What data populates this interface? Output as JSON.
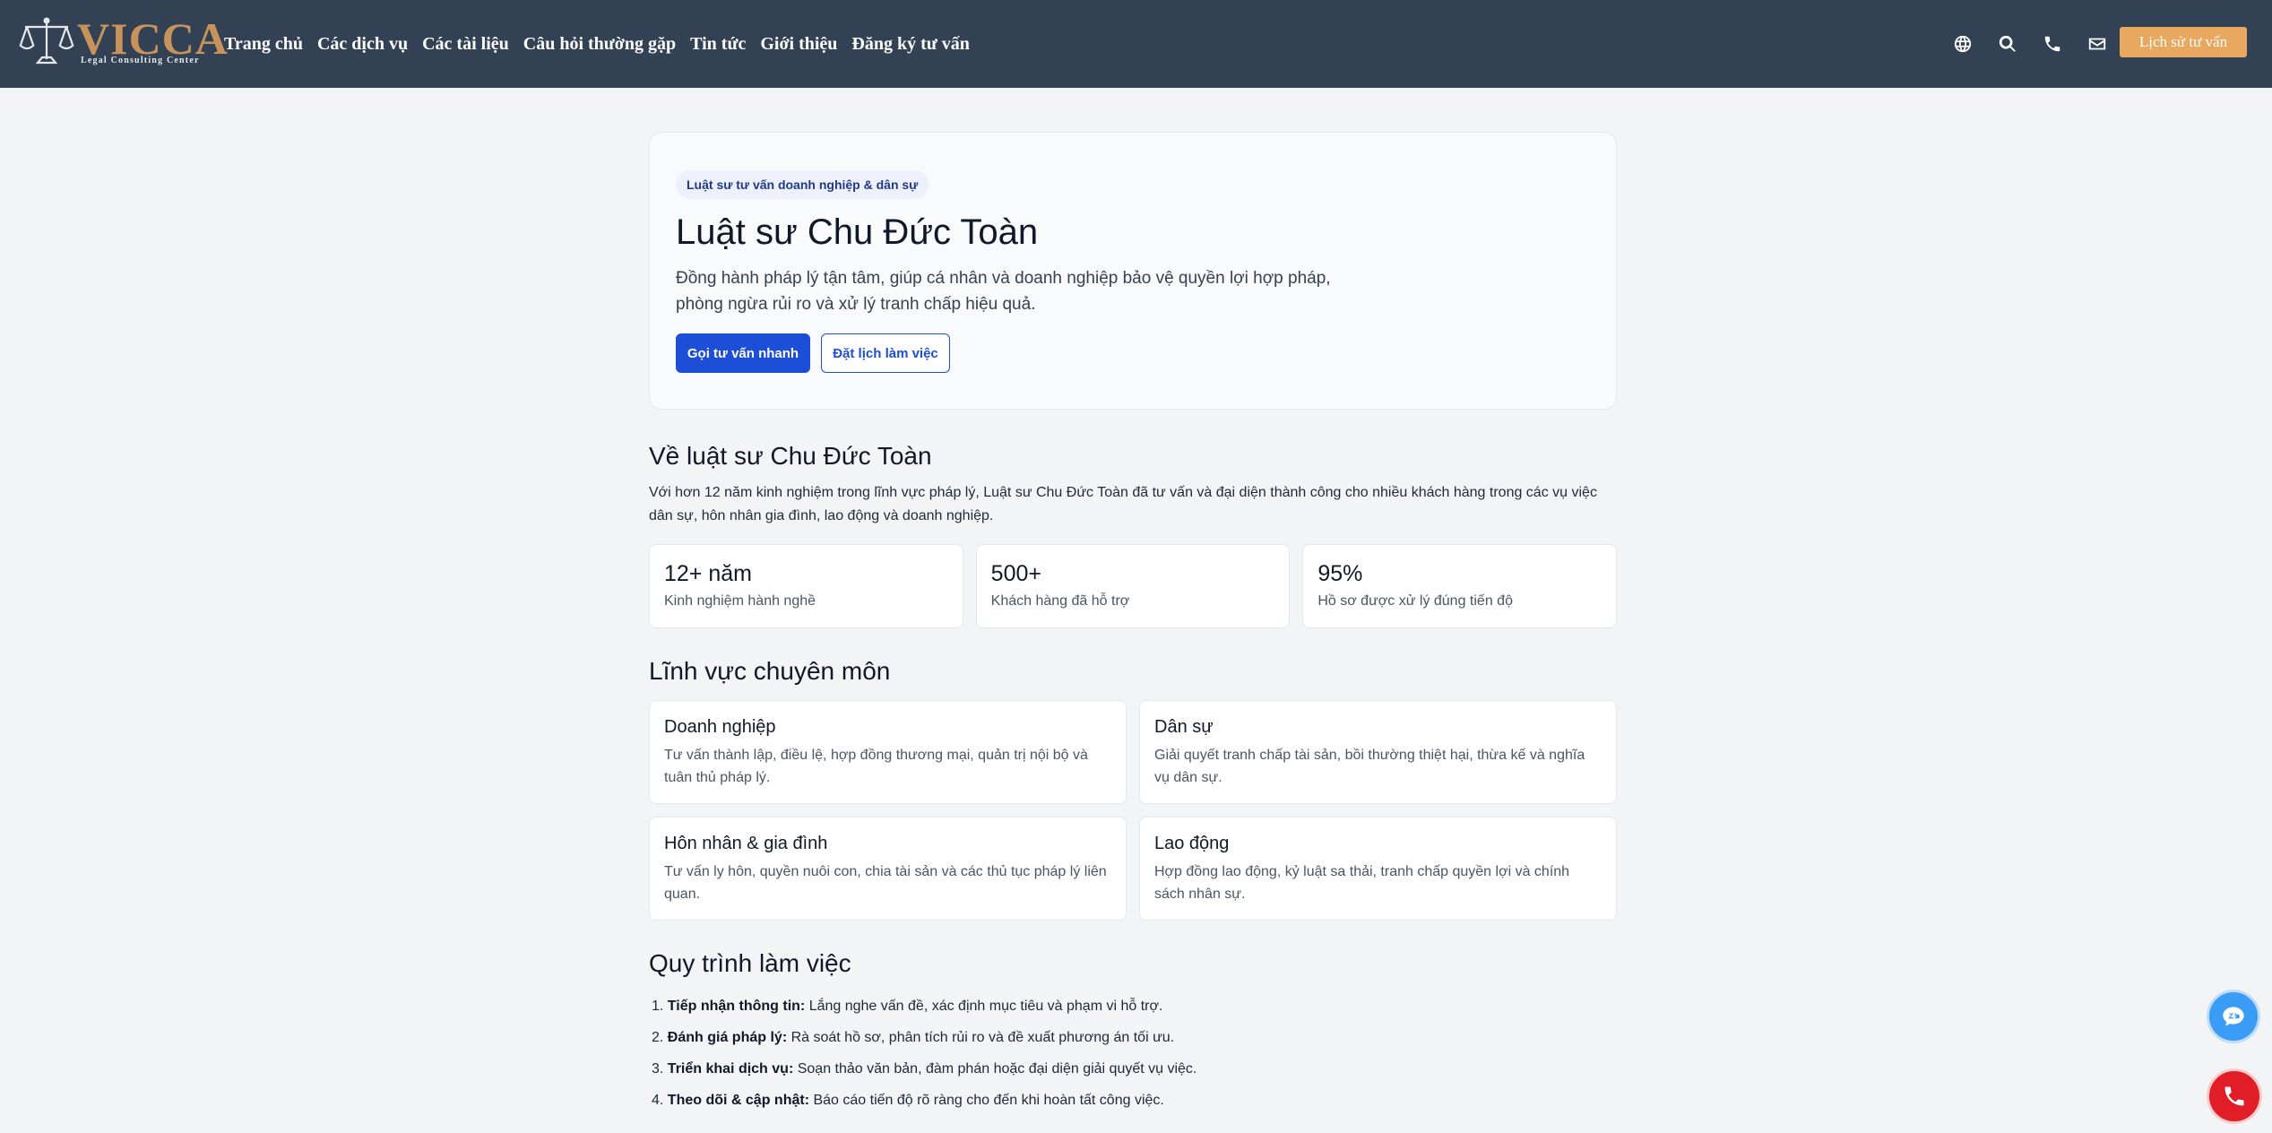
{
  "brand": {
    "name": "VICCA",
    "tagline": "Legal Consulting Center"
  },
  "nav": {
    "items": [
      "Trang chủ",
      "Các dịch vụ",
      "Các tài liệu",
      "Câu hỏi thường gặp",
      "Tin tức",
      "Giới thiệu",
      "Đăng ký tư vấn"
    ],
    "icons": [
      "globe-icon",
      "search-icon",
      "phone-icon",
      "mail-icon"
    ],
    "cta": "Lịch sử tư vấn"
  },
  "hero": {
    "badge": "Luật sư tư vấn doanh nghiệp & dân sự",
    "title": "Luật sư Chu Đức Toàn",
    "description": "Đồng hành pháp lý tận tâm, giúp cá nhân và doanh nghiệp bảo vệ quyền lợi hợp pháp, phòng ngừa rủi ro và xử lý tranh chấp hiệu quả.",
    "primary_button": "Gọi tư vấn nhanh",
    "secondary_button": "Đặt lịch làm việc"
  },
  "about": {
    "title": "Về luật sư Chu Đức Toàn",
    "text": "Với hơn 12 năm kinh nghiệm trong lĩnh vực pháp lý, Luật sư Chu Đức Toàn đã tư vấn và đại diện thành công cho nhiều khách hàng trong các vụ việc dân sự, hôn nhân gia đình, lao động và doanh nghiệp.",
    "stats": [
      {
        "value": "12+ năm",
        "label": "Kinh nghiệm hành nghề"
      },
      {
        "value": "500+",
        "label": "Khách hàng đã hỗ trợ"
      },
      {
        "value": "95%",
        "label": "Hồ sơ được xử lý đúng tiến độ"
      }
    ]
  },
  "fields": {
    "title": "Lĩnh vực chuyên môn",
    "items": [
      {
        "title": "Doanh nghiệp",
        "desc": "Tư vấn thành lập, điều lệ, hợp đồng thương mại, quản trị nội bộ và tuân thủ pháp lý."
      },
      {
        "title": "Dân sự",
        "desc": "Giải quyết tranh chấp tài sản, bồi thường thiệt hại, thừa kế và nghĩa vụ dân sự."
      },
      {
        "title": "Hôn nhân & gia đình",
        "desc": "Tư vấn ly hôn, quyền nuôi con, chia tài sản và các thủ tục pháp lý liên quan."
      },
      {
        "title": "Lao động",
        "desc": "Hợp đồng lao động, kỷ luật sa thải, tranh chấp quyền lợi và chính sách nhân sự."
      }
    ]
  },
  "process": {
    "title": "Quy trình làm việc",
    "steps": [
      {
        "num": "1.",
        "label": "Tiếp nhận thông tin:",
        "text": " Lắng nghe vấn đề, xác định mục tiêu và phạm vi hỗ trợ."
      },
      {
        "num": "2.",
        "label": "Đánh giá pháp lý:",
        "text": " Rà soát hồ sơ, phân tích rủi ro và đề xuất phương án tối ưu."
      },
      {
        "num": "3.",
        "label": "Triển khai dịch vụ:",
        "text": " Soạn thảo văn bản, đàm phán hoặc đại diện giải quyết vụ việc."
      },
      {
        "num": "4.",
        "label": "Theo dõi & cập nhật:",
        "text": " Báo cáo tiến độ rõ ràng cho đến khi hoàn tất công việc."
      }
    ]
  },
  "floating": {
    "chat_icon": "zalo-chat-icon",
    "call_icon": "phone-call-icon"
  }
}
